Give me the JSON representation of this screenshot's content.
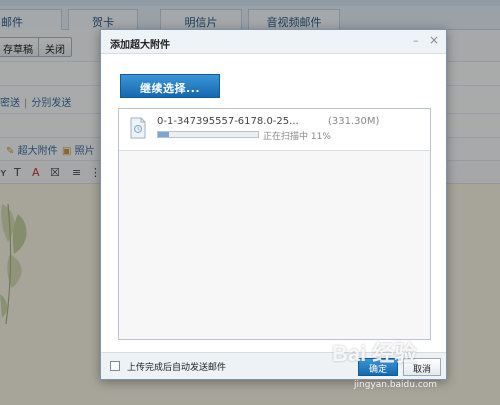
{
  "background": {
    "tabs": [
      "邮件",
      "贺卡",
      "明信片",
      "音视频邮件"
    ],
    "toolbar": {
      "save_draft": "存草稿",
      "close": "关闭"
    },
    "send_links": [
      "密送",
      "分别发送"
    ],
    "attach_options": [
      "超大附件",
      "照片"
    ],
    "format_icons": [
      "T",
      "T",
      "A",
      "≡"
    ]
  },
  "dialog": {
    "title": "添加超大附件",
    "minimize_glyph": "–",
    "close_glyph": "×",
    "continue_button": "继续选择...",
    "files": [
      {
        "name": "0-1-347395557-6178.0-25...",
        "size": "(331.30M)",
        "status": "正在扫描中 11%",
        "progress": 0.11
      }
    ],
    "footer": {
      "auto_send_label": "上传完成后自动发送邮件",
      "auto_send_checked": false,
      "ok_button": "确定",
      "cancel_button": "取消"
    }
  },
  "watermark": {
    "main": "Bai 经验",
    "sub": "jingyan.baidu.com"
  },
  "colors": {
    "primary_button": "#1f78c1",
    "editor_background": "#f7f3e3",
    "progress_fill": "#7aa7d0"
  }
}
